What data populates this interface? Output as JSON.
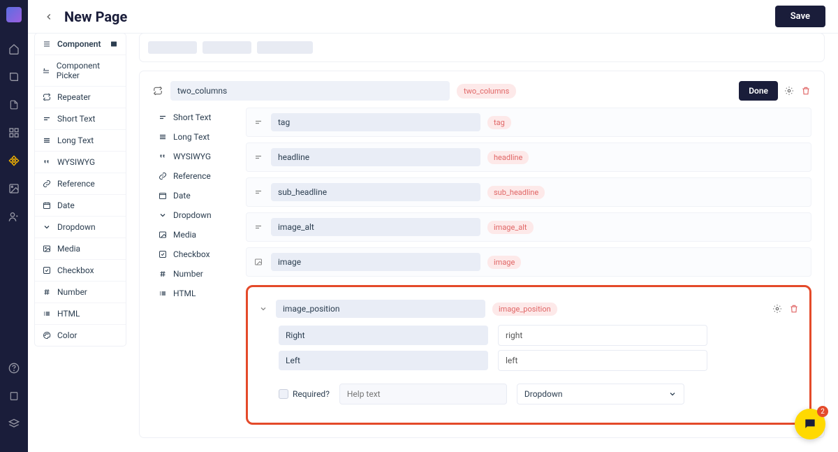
{
  "header": {
    "title": "New Page",
    "save_label": "Save"
  },
  "field_types": {
    "component": "Component",
    "component_picker": "Component Picker",
    "repeater": "Repeater",
    "short_text": "Short Text",
    "long_text": "Long Text",
    "wysiwyg": "WYSIWYG",
    "reference": "Reference",
    "date": "Date",
    "dropdown": "Dropdown",
    "media": "Media",
    "checkbox": "Checkbox",
    "number": "Number",
    "html": "HTML",
    "color": "Color"
  },
  "block": {
    "name": "two_columns",
    "tag": "two_columns",
    "done_label": "Done",
    "fields": [
      {
        "name": "tag",
        "tag": "tag"
      },
      {
        "name": "headline",
        "tag": "headline"
      },
      {
        "name": "sub_headline",
        "tag": "sub_headline"
      },
      {
        "name": "image_alt",
        "tag": "image_alt"
      },
      {
        "name": "image",
        "tag": "image"
      }
    ],
    "expanded": {
      "name": "image_position",
      "tag": "image_position",
      "options": [
        {
          "label": "Right",
          "value": "right"
        },
        {
          "label": "Left",
          "value": "left"
        }
      ],
      "required_label": "Required?",
      "help_placeholder": "Help text",
      "type_value": "Dropdown"
    }
  },
  "chat": {
    "badge": "2"
  }
}
